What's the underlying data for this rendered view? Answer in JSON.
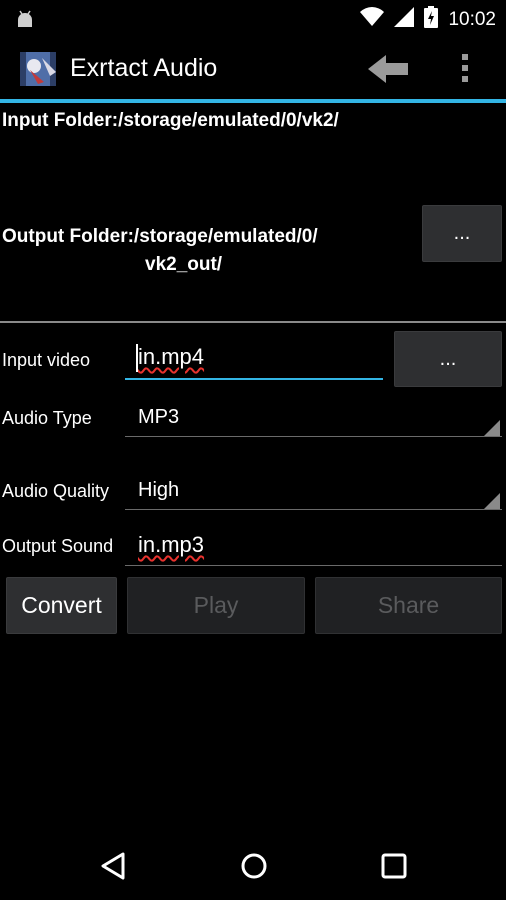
{
  "status_bar": {
    "time": "10:02"
  },
  "action_bar": {
    "title": "Exrtact Audio"
  },
  "input_folder": {
    "label": "Input Folder:/storage/emulated/0/vk2/"
  },
  "output_folder": {
    "label_line1": "Output Folder:/storage/emulated/0/",
    "label_line2": "vk2_out/",
    "browse_label": "..."
  },
  "input_video": {
    "label": "Input video",
    "value": "in.mp4",
    "browse_label": "..."
  },
  "audio_type": {
    "label": "Audio Type",
    "value": "MP3"
  },
  "audio_quality": {
    "label": "Audio Quality",
    "value": "High"
  },
  "output_sound": {
    "label": "Output Sound",
    "value": "in.mp3"
  },
  "buttons": {
    "convert": "Convert",
    "play": "Play",
    "share": "Share"
  },
  "colors": {
    "accent": "#33b5e5",
    "button_bg": "#2e2f31",
    "spell_error": "#e8322e"
  }
}
